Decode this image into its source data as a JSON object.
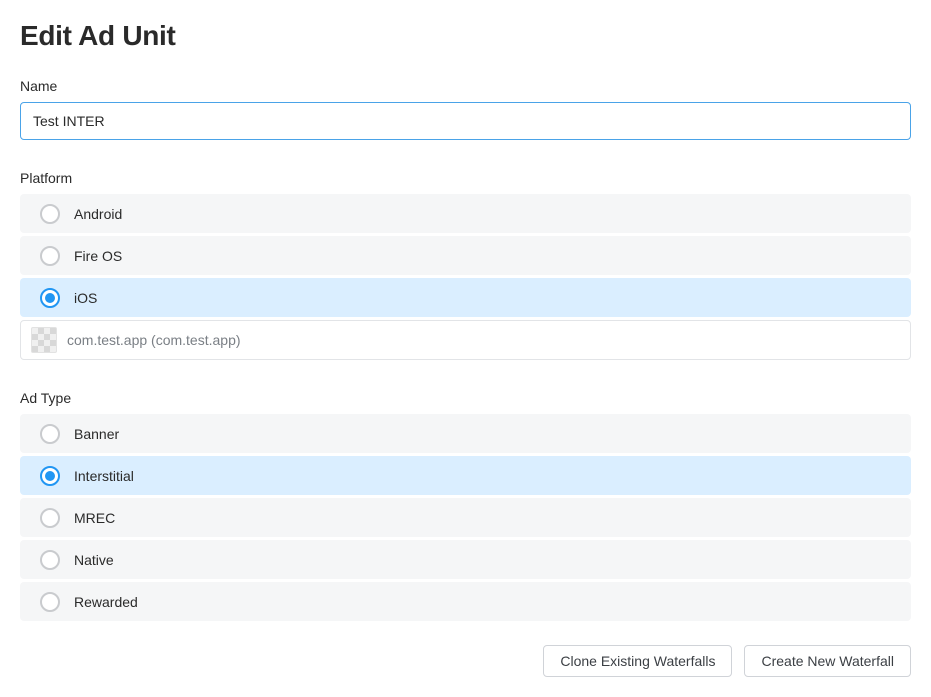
{
  "title": "Edit Ad Unit",
  "name": {
    "label": "Name",
    "value": "Test INTER"
  },
  "platform": {
    "label": "Platform",
    "options": [
      {
        "label": "Android",
        "selected": false
      },
      {
        "label": "Fire OS",
        "selected": false
      },
      {
        "label": "iOS",
        "selected": true
      }
    ],
    "app": {
      "display": "com.test.app (com.test.app)"
    }
  },
  "adType": {
    "label": "Ad Type",
    "options": [
      {
        "label": "Banner",
        "selected": false
      },
      {
        "label": "Interstitial",
        "selected": true
      },
      {
        "label": "MREC",
        "selected": false
      },
      {
        "label": "Native",
        "selected": false
      },
      {
        "label": "Rewarded",
        "selected": false
      }
    ]
  },
  "buttons": {
    "clone": "Clone Existing Waterfalls",
    "create": "Create New Waterfall"
  }
}
